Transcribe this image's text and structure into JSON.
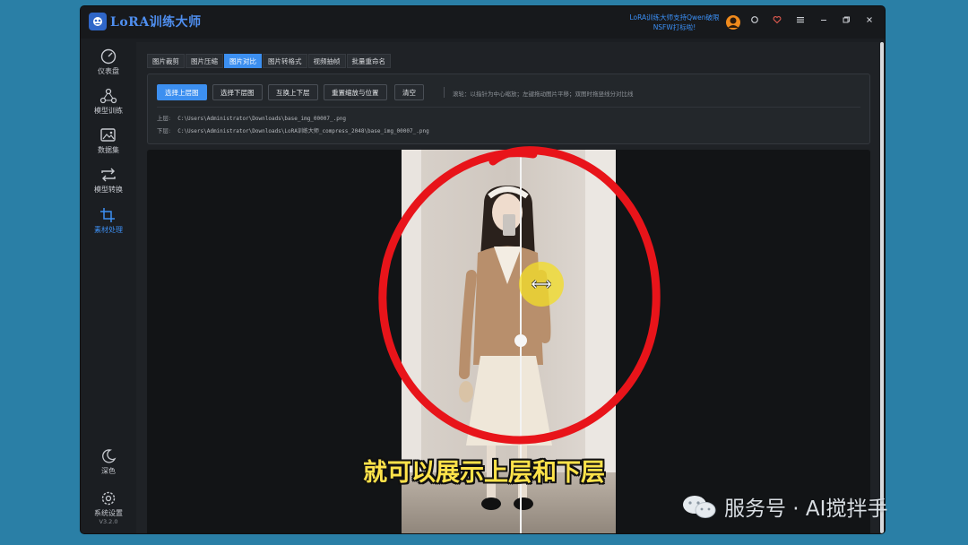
{
  "app": {
    "title": "LoRA训练大师",
    "promo_line1": "LoRA训练大师支持Qwen破限",
    "promo_line2": "NSFW打标啦!"
  },
  "titlebar": {
    "icons": [
      "avatar-icon",
      "refresh-icon",
      "heart-icon",
      "menu-icon",
      "minimize-icon",
      "restore-icon",
      "close-icon"
    ]
  },
  "sidebar": {
    "items": [
      {
        "label": "仪表盘",
        "icon": "gauge-icon"
      },
      {
        "label": "模型训练",
        "icon": "network-icon"
      },
      {
        "label": "数据集",
        "icon": "images-icon"
      },
      {
        "label": "模型转换",
        "icon": "convert-icon"
      },
      {
        "label": "素材处理",
        "icon": "crop-icon",
        "active": true
      }
    ],
    "bottom": [
      {
        "label": "深色",
        "icon": "moon-icon"
      },
      {
        "label": "系统设置",
        "icon": "gear-icon",
        "version": "V3.2.0"
      }
    ]
  },
  "tabs": [
    "图片裁剪",
    "图片压缩",
    "图片对比",
    "图片转格式",
    "视频抽帧",
    "批量重命名"
  ],
  "active_tab_index": 2,
  "toolbar": {
    "buttons": [
      "选择上层图",
      "选择下层图",
      "互换上下层",
      "重置缩放与位置",
      "清空"
    ],
    "hint": "滚轮：以指针为中心缩放；左键拖动图片平移；双图时拖竖线分对比线"
  },
  "paths": {
    "upper_label": "上层:",
    "upper_value": "C:\\Users\\Administrator\\Downloads\\base_img_00007_.png",
    "lower_label": "下层:",
    "lower_value": "C:\\Users\\Administrator\\Downloads\\LoRA训练大师_compress_2048\\base_img_00007_.png"
  },
  "overlay": {
    "subtitle": "就可以展示上层和下层",
    "watermark": "服务号 · AI搅拌手"
  },
  "colors": {
    "accent": "#3c8ff0",
    "annotation_red": "#e8141a",
    "subtitle_yellow": "#ffe34a"
  }
}
